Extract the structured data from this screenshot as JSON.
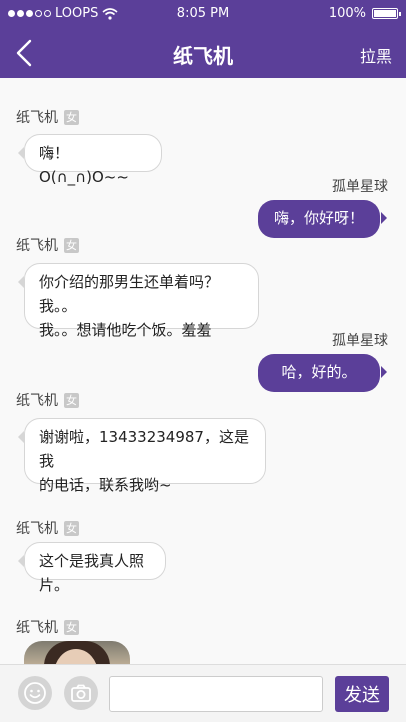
{
  "status_bar": {
    "carrier": "LOOPS",
    "time": "8:05 PM",
    "battery": "100%",
    "battery_level": 1.0,
    "signal_dots_filled": 3,
    "signal_dots_total": 5,
    "icons": [
      "signal-dots-icon",
      "wifi-icon",
      "battery-icon"
    ]
  },
  "nav": {
    "back_icon": "chevron-left-icon",
    "title": "纸飞机",
    "right_action": "拉黑"
  },
  "messages": [
    {
      "from": "other",
      "sender": "纸飞机",
      "gender": "女",
      "lines": [
        "嗨！O(∩_∩)O~~"
      ]
    },
    {
      "from": "me",
      "sender": "孤单星球",
      "lines": [
        "嗨，你好呀！"
      ]
    },
    {
      "from": "other",
      "sender": "纸飞机",
      "gender": "女",
      "lines": [
        "你介绍的那男生还单着吗？我。。",
        "我。。想请他吃个饭。羞羞"
      ]
    },
    {
      "from": "me",
      "sender": "孤单星球",
      "lines": [
        "哈，好的。"
      ]
    },
    {
      "from": "other",
      "sender": "纸飞机",
      "gender": "女",
      "lines": [
        "谢谢啦，13433234987，这是我",
        "的电话，联系我哟~"
      ]
    },
    {
      "from": "other",
      "sender": "纸飞机",
      "gender": "女",
      "lines": [
        "这个是我真人照片。"
      ]
    },
    {
      "from": "other",
      "sender": "纸飞机",
      "gender": "女",
      "image": "photo-message"
    }
  ],
  "input_bar": {
    "emoji_icon": "emoji-icon",
    "camera_icon": "camera-icon",
    "input_value": "",
    "send_label": "发送"
  },
  "colors": {
    "primary": "#5b3f99",
    "background": "#f9f9f9",
    "bubble_border": "#d6d6d6",
    "gender_badge": "#c8c8c8"
  }
}
